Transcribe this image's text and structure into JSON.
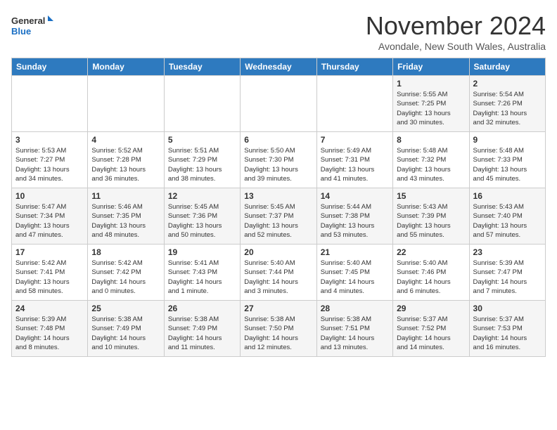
{
  "logo": {
    "line1": "General",
    "line2": "Blue"
  },
  "title": "November 2024",
  "location": "Avondale, New South Wales, Australia",
  "days_of_week": [
    "Sunday",
    "Monday",
    "Tuesday",
    "Wednesday",
    "Thursday",
    "Friday",
    "Saturday"
  ],
  "weeks": [
    [
      {
        "day": "",
        "info": ""
      },
      {
        "day": "",
        "info": ""
      },
      {
        "day": "",
        "info": ""
      },
      {
        "day": "",
        "info": ""
      },
      {
        "day": "",
        "info": ""
      },
      {
        "day": "1",
        "info": "Sunrise: 5:55 AM\nSunset: 7:25 PM\nDaylight: 13 hours\nand 30 minutes."
      },
      {
        "day": "2",
        "info": "Sunrise: 5:54 AM\nSunset: 7:26 PM\nDaylight: 13 hours\nand 32 minutes."
      }
    ],
    [
      {
        "day": "3",
        "info": "Sunrise: 5:53 AM\nSunset: 7:27 PM\nDaylight: 13 hours\nand 34 minutes."
      },
      {
        "day": "4",
        "info": "Sunrise: 5:52 AM\nSunset: 7:28 PM\nDaylight: 13 hours\nand 36 minutes."
      },
      {
        "day": "5",
        "info": "Sunrise: 5:51 AM\nSunset: 7:29 PM\nDaylight: 13 hours\nand 38 minutes."
      },
      {
        "day": "6",
        "info": "Sunrise: 5:50 AM\nSunset: 7:30 PM\nDaylight: 13 hours\nand 39 minutes."
      },
      {
        "day": "7",
        "info": "Sunrise: 5:49 AM\nSunset: 7:31 PM\nDaylight: 13 hours\nand 41 minutes."
      },
      {
        "day": "8",
        "info": "Sunrise: 5:48 AM\nSunset: 7:32 PM\nDaylight: 13 hours\nand 43 minutes."
      },
      {
        "day": "9",
        "info": "Sunrise: 5:48 AM\nSunset: 7:33 PM\nDaylight: 13 hours\nand 45 minutes."
      }
    ],
    [
      {
        "day": "10",
        "info": "Sunrise: 5:47 AM\nSunset: 7:34 PM\nDaylight: 13 hours\nand 47 minutes."
      },
      {
        "day": "11",
        "info": "Sunrise: 5:46 AM\nSunset: 7:35 PM\nDaylight: 13 hours\nand 48 minutes."
      },
      {
        "day": "12",
        "info": "Sunrise: 5:45 AM\nSunset: 7:36 PM\nDaylight: 13 hours\nand 50 minutes."
      },
      {
        "day": "13",
        "info": "Sunrise: 5:45 AM\nSunset: 7:37 PM\nDaylight: 13 hours\nand 52 minutes."
      },
      {
        "day": "14",
        "info": "Sunrise: 5:44 AM\nSunset: 7:38 PM\nDaylight: 13 hours\nand 53 minutes."
      },
      {
        "day": "15",
        "info": "Sunrise: 5:43 AM\nSunset: 7:39 PM\nDaylight: 13 hours\nand 55 minutes."
      },
      {
        "day": "16",
        "info": "Sunrise: 5:43 AM\nSunset: 7:40 PM\nDaylight: 13 hours\nand 57 minutes."
      }
    ],
    [
      {
        "day": "17",
        "info": "Sunrise: 5:42 AM\nSunset: 7:41 PM\nDaylight: 13 hours\nand 58 minutes."
      },
      {
        "day": "18",
        "info": "Sunrise: 5:42 AM\nSunset: 7:42 PM\nDaylight: 14 hours\nand 0 minutes."
      },
      {
        "day": "19",
        "info": "Sunrise: 5:41 AM\nSunset: 7:43 PM\nDaylight: 14 hours\nand 1 minute."
      },
      {
        "day": "20",
        "info": "Sunrise: 5:40 AM\nSunset: 7:44 PM\nDaylight: 14 hours\nand 3 minutes."
      },
      {
        "day": "21",
        "info": "Sunrise: 5:40 AM\nSunset: 7:45 PM\nDaylight: 14 hours\nand 4 minutes."
      },
      {
        "day": "22",
        "info": "Sunrise: 5:40 AM\nSunset: 7:46 PM\nDaylight: 14 hours\nand 6 minutes."
      },
      {
        "day": "23",
        "info": "Sunrise: 5:39 AM\nSunset: 7:47 PM\nDaylight: 14 hours\nand 7 minutes."
      }
    ],
    [
      {
        "day": "24",
        "info": "Sunrise: 5:39 AM\nSunset: 7:48 PM\nDaylight: 14 hours\nand 8 minutes."
      },
      {
        "day": "25",
        "info": "Sunrise: 5:38 AM\nSunset: 7:49 PM\nDaylight: 14 hours\nand 10 minutes."
      },
      {
        "day": "26",
        "info": "Sunrise: 5:38 AM\nSunset: 7:49 PM\nDaylight: 14 hours\nand 11 minutes."
      },
      {
        "day": "27",
        "info": "Sunrise: 5:38 AM\nSunset: 7:50 PM\nDaylight: 14 hours\nand 12 minutes."
      },
      {
        "day": "28",
        "info": "Sunrise: 5:38 AM\nSunset: 7:51 PM\nDaylight: 14 hours\nand 13 minutes."
      },
      {
        "day": "29",
        "info": "Sunrise: 5:37 AM\nSunset: 7:52 PM\nDaylight: 14 hours\nand 14 minutes."
      },
      {
        "day": "30",
        "info": "Sunrise: 5:37 AM\nSunset: 7:53 PM\nDaylight: 14 hours\nand 16 minutes."
      }
    ]
  ]
}
